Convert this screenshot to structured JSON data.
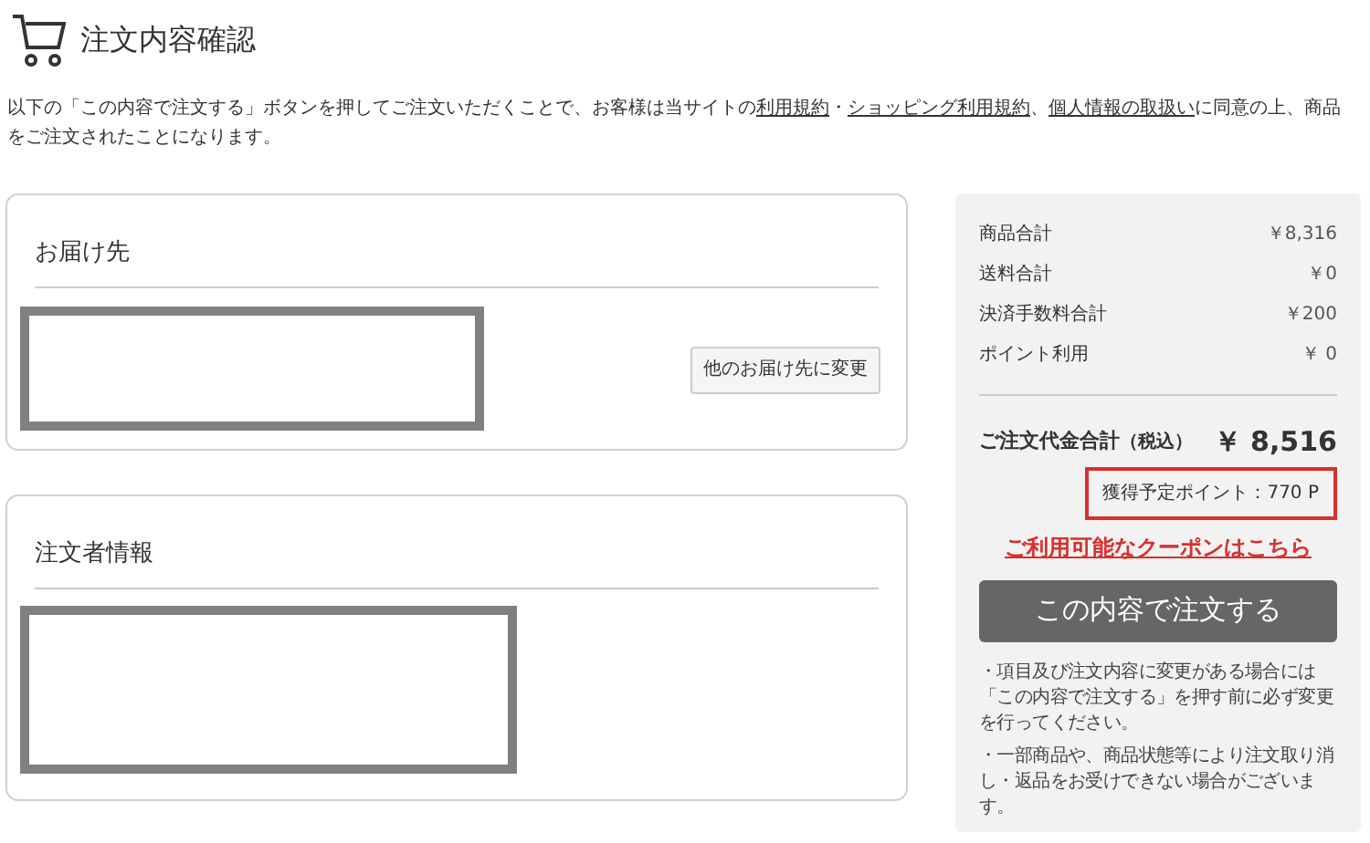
{
  "page_title": "注文内容確認",
  "intro": [
    {
      "kind": "text",
      "text": "以下の「この内容で注文する」ボタンを押してご注文いただくことで、お客様は当サイトの"
    },
    {
      "kind": "link",
      "text": "利用規約"
    },
    {
      "kind": "text",
      "text": "・"
    },
    {
      "kind": "link",
      "text": "ショッピング利用規約"
    },
    {
      "kind": "text",
      "text": "、"
    },
    {
      "kind": "link",
      "text": "個人情報の取扱い"
    },
    {
      "kind": "text",
      "text": "に同意の上、商品をご注文されたことになります。"
    }
  ],
  "cards": [
    {
      "title": "お届け先",
      "button": "他のお届け先に変更"
    },
    {
      "title": "注文者情報"
    }
  ],
  "summary": {
    "rows": [
      {
        "label": "商品合計",
        "value": "￥8,316"
      },
      {
        "label": "送料合計",
        "value": "￥0"
      },
      {
        "label": "決済手数料合計",
        "value": "￥200"
      },
      {
        "label": "ポイント利用",
        "value": "￥ 0"
      }
    ],
    "total_label": "ご注文代金合計",
    "total_note": "（税込）",
    "total_value": "￥ 8,516",
    "points": {
      "text": "獲得予定ポイント：770 P",
      "highlighted": true
    },
    "coupon_link": "ご利用可能なクーポンはこちら",
    "order_button": "この内容で注文する",
    "notes": [
      "・項目及び注文内容に変更がある場合には「この内容で注文する」を押す前に必ず変更を行ってください。",
      "・一部商品や、商品状態等により注文取り消し・返品をお受けできない場合がございます。"
    ]
  }
}
